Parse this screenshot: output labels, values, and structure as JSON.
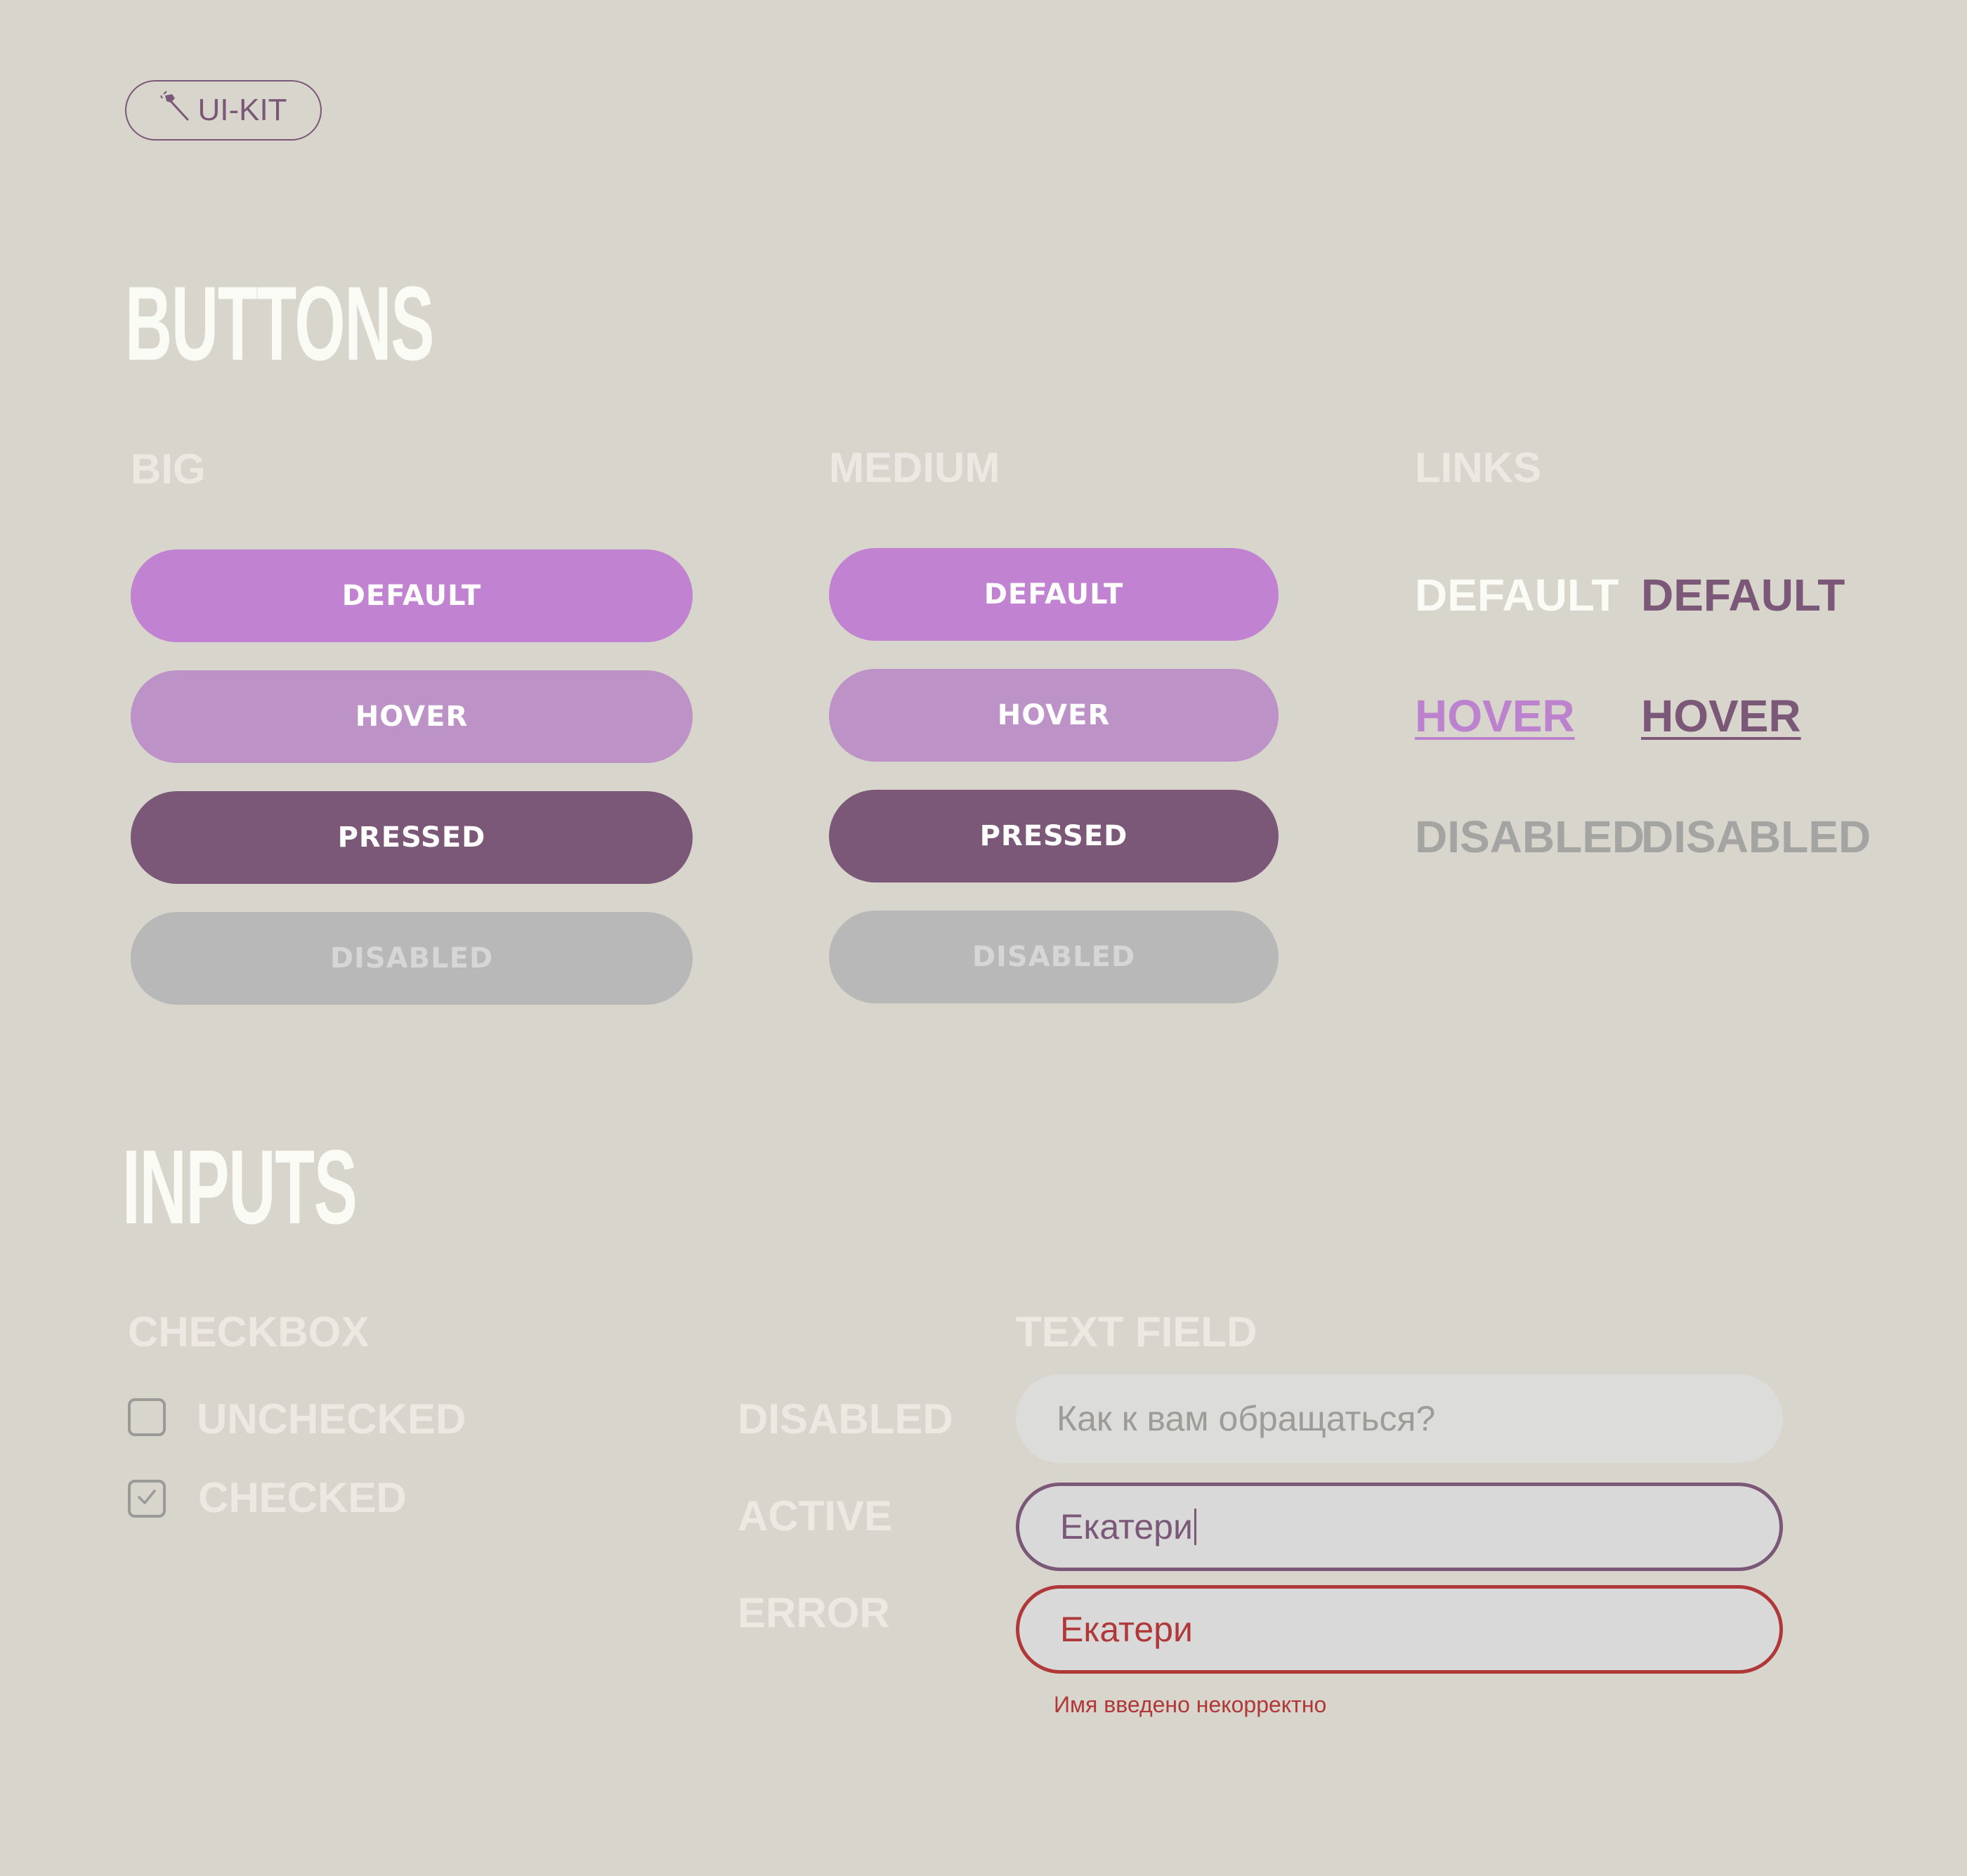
{
  "kit": {
    "label": "UI-KIT",
    "icon": "brush-icon"
  },
  "buttons": {
    "title": "BUTTONS",
    "big": {
      "title": "BIG",
      "default": "DEFAULT",
      "hover": "HOVER",
      "pressed": "PRESSED",
      "disabled": "DISABLED"
    },
    "medium": {
      "title": "MEDIUM",
      "default": "DEFAULT",
      "hover": "HOVER",
      "pressed": "PRESSED",
      "disabled": "DISABLED"
    },
    "links": {
      "title": "LINKS",
      "light": {
        "default": "DEFAULT",
        "hover": "HOVER",
        "disabled": "DISABLED"
      },
      "dark": {
        "default": "DEFAULT",
        "hover": "HOVER",
        "disabled": "DISABLED"
      }
    }
  },
  "inputs": {
    "title": "INPUTS",
    "checkbox": {
      "title": "CHECKBOX",
      "unchecked": "UNCHECKED",
      "checked": "CHECKED"
    },
    "text_field": {
      "title": "TEXT FIELD",
      "states": {
        "disabled": "DISABLED",
        "active": "ACTIVE",
        "error": "ERROR"
      },
      "disabled_placeholder": "Как к вам обращаться?",
      "active_value": "Екатери",
      "error_value": "Екатери",
      "error_message": "Имя введено некорректно"
    }
  },
  "colors": {
    "background": "#d8d5cd",
    "primary": "#c082d1",
    "hover": "#bc92c7",
    "pressed": "#7c5878",
    "disabled": "#b8b8b8",
    "error": "#b03838"
  }
}
